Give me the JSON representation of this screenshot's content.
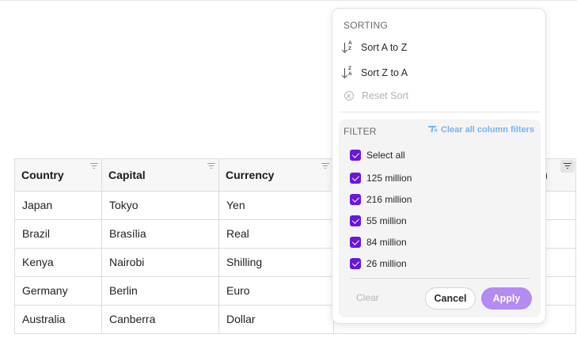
{
  "table": {
    "columns": [
      {
        "label": "Country"
      },
      {
        "label": "Capital"
      },
      {
        "label": "Currency"
      }
    ],
    "partial_header_fragment": ")",
    "rows": [
      {
        "country": "Japan",
        "capital": "Tokyo",
        "currency": "Yen"
      },
      {
        "country": "Brazil",
        "capital": "Brasília",
        "currency": "Real"
      },
      {
        "country": "Kenya",
        "capital": "Nairobi",
        "currency": "Shilling"
      },
      {
        "country": "Germany",
        "capital": "Berlin",
        "currency": "Euro"
      },
      {
        "country": "Australia",
        "capital": "Canberra",
        "currency": "Dollar"
      }
    ]
  },
  "menu": {
    "sorting_title": "SORTING",
    "sort_asc_label": "Sort A to Z",
    "sort_desc_label": "Sort Z to A",
    "reset_sort_label": "Reset Sort",
    "filter_title": "FILTER",
    "clear_all_label": "Clear all column filters",
    "select_all_label": "Select all",
    "options": [
      {
        "label": "125 million",
        "checked": true
      },
      {
        "label": "216 million",
        "checked": true
      },
      {
        "label": "55 million",
        "checked": true
      },
      {
        "label": "84 million",
        "checked": true
      },
      {
        "label": "26 million",
        "checked": true
      }
    ],
    "clear_label": "Clear",
    "cancel_label": "Cancel",
    "apply_label": "Apply"
  },
  "colors": {
    "accent": "#6a16e0",
    "apply_button": "#b48af3",
    "link": "#7ab0f0"
  },
  "icons": [
    "filter-icon",
    "sort-ascending-icon",
    "sort-descending-icon",
    "reset-icon",
    "clear-filter-icon",
    "checkbox-checked-icon"
  ]
}
